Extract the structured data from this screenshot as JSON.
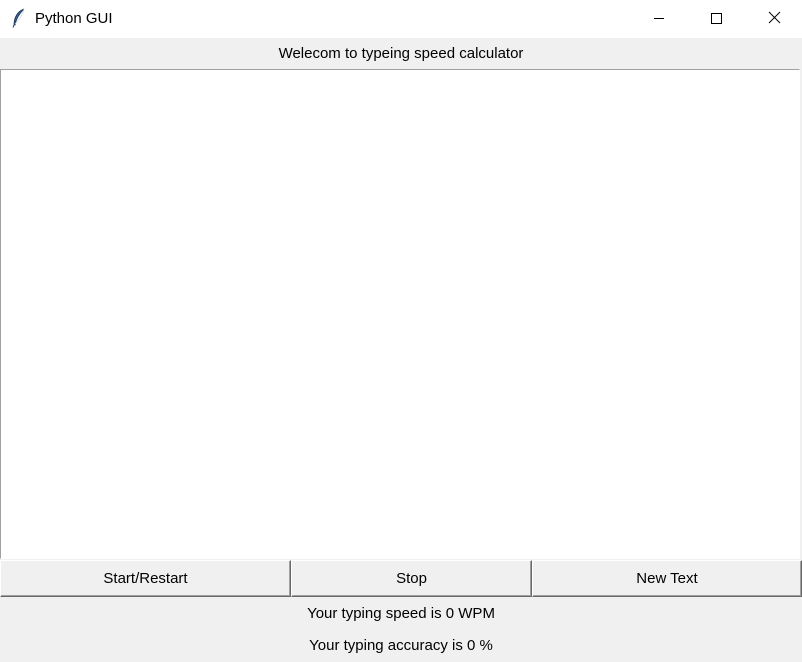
{
  "window": {
    "title": "Python GUI",
    "icon": "feather-icon",
    "controls": {
      "minimize": "minimize-icon",
      "maximize": "maximize-icon",
      "close": "close-icon"
    }
  },
  "header": {
    "text": "Welecom to typeing speed calculator"
  },
  "text_area": {
    "value": ""
  },
  "buttons": {
    "start_label": "Start/Restart",
    "stop_label": "Stop",
    "new_text_label": "New Text"
  },
  "results": {
    "speed_text": "Your typing speed is 0 WPM",
    "accuracy_text": "Your typing accuracy is 0 %"
  }
}
